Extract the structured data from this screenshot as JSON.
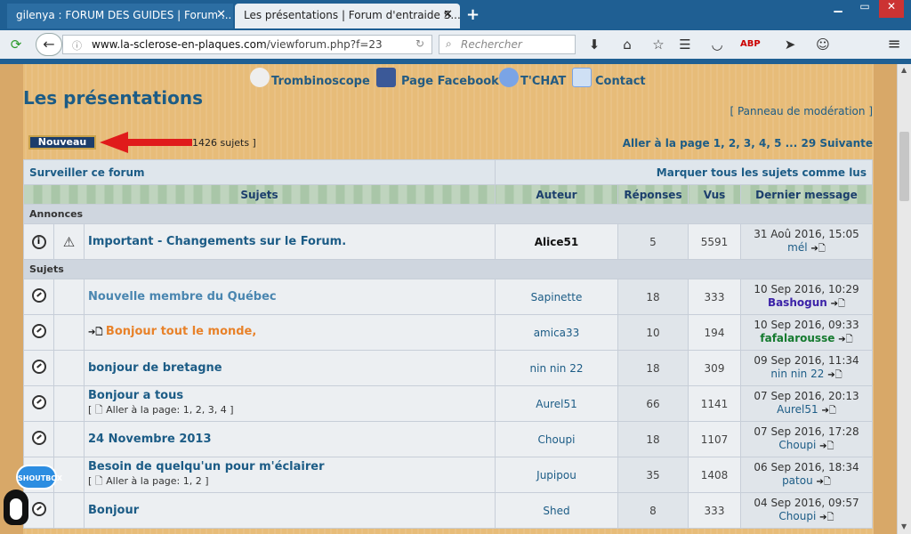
{
  "browser": {
    "tabs": [
      {
        "title": "gilenya : FORUM DES GUIDES | Forum ...",
        "active": false
      },
      {
        "title": "Les présentations | Forum d'entraide S...",
        "active": true
      }
    ],
    "url_host": "www.la-sclerose-en-plaques.com",
    "url_path": "/viewforum.php?f=23",
    "search_placeholder": "Rechercher",
    "new_tab_glyph": "+",
    "close_glyph": "✕",
    "window_controls": [
      "▁",
      "▭",
      "✕"
    ]
  },
  "site_links": [
    {
      "label": "Trombinoscope",
      "icon": "trombinoscope-icon"
    },
    {
      "label": "Page Facebook",
      "icon": "facebook-icon"
    },
    {
      "label": "T'CHAT",
      "icon": "chat-icon"
    },
    {
      "label": "Contact",
      "icon": "contact-icon"
    }
  ],
  "forum": {
    "title": "Les présentations",
    "moderation_link": "[ Panneau de modération ]",
    "new_button": "Nouveau",
    "topic_count": "1426 sujets ]",
    "pagination": "Aller à la page 1, 2, 3, 4, 5 ... 29  Suivante",
    "watch_link": "Surveiller ce forum",
    "mark_read_link": "Marquer tous les sujets comme lus",
    "columns": [
      "Sujets",
      "Auteur",
      "Réponses",
      "Vus",
      "Dernier message"
    ],
    "announcements_label": "Annonces",
    "topics_label": "Sujets",
    "announcements": [
      {
        "title": "Important - Changements sur le Forum.",
        "author": "Alice51",
        "replies": "5",
        "views": "5591",
        "last_date": "31 Aoû 2016, 15:05",
        "last_user": "mél"
      }
    ],
    "topics": [
      {
        "title": "Nouvelle membre du Québec",
        "author": "Sapinette",
        "replies": "18",
        "views": "333",
        "last_date": "10 Sep 2016, 10:29",
        "last_user": "Bashogun",
        "pages": "",
        "last_color": "#3b22a8"
      },
      {
        "title": "Bonjour tout le monde,",
        "author": "amica33",
        "replies": "10",
        "views": "194",
        "last_date": "10 Sep 2016, 09:33",
        "last_user": "fafalarousse",
        "pages": "",
        "last_color": "#157a2f"
      },
      {
        "title": "bonjour de bretagne",
        "author": "nin nin 22",
        "replies": "18",
        "views": "309",
        "last_date": "09 Sep 2016, 11:34",
        "last_user": "nin nin 22",
        "pages": "",
        "last_color": "#1c5c86"
      },
      {
        "title": "Bonjour a tous",
        "author": "Aurel51",
        "replies": "66",
        "views": "1141",
        "last_date": "07 Sep 2016, 20:13",
        "last_user": "Aurel51",
        "pages": "[ 🗋 Aller à la page: 1, 2, 3, 4 ]",
        "last_color": "#1c5c86"
      },
      {
        "title": "24 Novembre 2013",
        "author": "Choupi",
        "replies": "18",
        "views": "1107",
        "last_date": "07 Sep 2016, 17:28",
        "last_user": "Choupi",
        "pages": "",
        "last_color": "#1c5c86"
      },
      {
        "title": "Besoin de quelqu'un pour m'éclairer",
        "author": "Jupipou",
        "replies": "35",
        "views": "1408",
        "last_date": "06 Sep 2016, 18:34",
        "last_user": "patou",
        "pages": "[ 🗋 Aller à la page: 1, 2 ]",
        "last_color": "#1c5c86"
      },
      {
        "title": "Bonjour",
        "author": "Shed",
        "replies": "8",
        "views": "333",
        "last_date": "04 Sep 2016, 09:57",
        "last_user": "Choupi",
        "pages": "",
        "last_color": "#1c5c86"
      }
    ]
  },
  "shoutbox_label": "SHOUTBOX",
  "colors": {
    "accent": "#1c5c86",
    "unread_title": "#e8822a",
    "read_title": "#4a86b0"
  }
}
